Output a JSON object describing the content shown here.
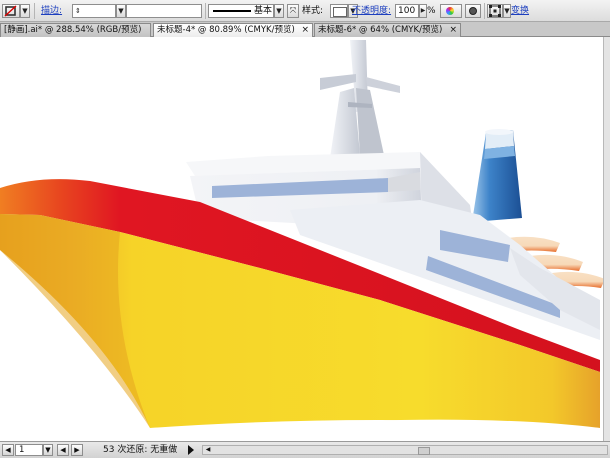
{
  "control_bar": {
    "stroke_label": "描边:",
    "stroke_style": "基本",
    "style_label": "样式:",
    "opacity_label": "不透明度:",
    "opacity_value": "100",
    "percent_sign": "%",
    "transform_label": "变换"
  },
  "tabs": [
    {
      "title": "[静画].ai* @ 288.54% (RGB/预览)",
      "active": false
    },
    {
      "title": "未标题-4* @ 80.89% (CMYK/预览)",
      "active": true
    },
    {
      "title": "未标题-6* @ 64% (CMYK/预览)",
      "active": false
    }
  ],
  "status_bar": {
    "page_value": "1",
    "status_text": "53 次还原: 无重做"
  },
  "colors": {
    "hull_yellow": "#f6d328",
    "hull_orange": "#e79a1d",
    "stripe_red": "#e01622",
    "cabin_white": "#f3f4f7",
    "window_blue": "#9db3d8",
    "funnel_blue": "#2f6fb8"
  },
  "icons": {
    "stroke_swatch": "none-stroke-icon",
    "close": "close-icon",
    "play": "play-icon"
  }
}
